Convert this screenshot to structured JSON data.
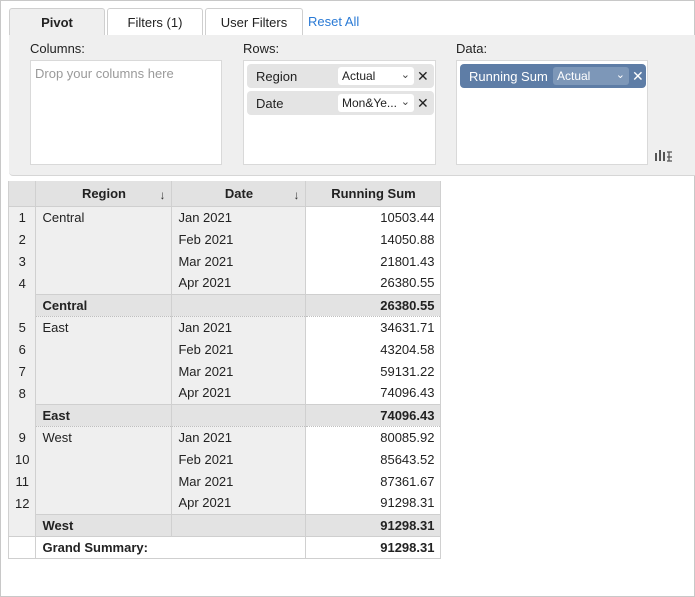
{
  "tabs": [
    {
      "label": "Pivot",
      "active": true
    },
    {
      "label": "Filters (1)",
      "active": false
    },
    {
      "label": "User Filters",
      "active": false
    }
  ],
  "reset_label": "Reset All",
  "panel": {
    "columns_label": "Columns:",
    "columns_placeholder": "Drop your columns here",
    "rows_label": "Rows:",
    "rows": [
      {
        "label": "Region",
        "value": "Actual"
      },
      {
        "label": "Date",
        "value": "Mon&Ye..."
      }
    ],
    "data_label": "Data:",
    "data": [
      {
        "label": "Running Sum",
        "value": "Actual"
      }
    ],
    "layout_icon": "chart-layout-icon",
    "accent_color": "#5e7da6"
  },
  "table": {
    "headers": {
      "region": "Region",
      "date": "Date",
      "sum": "Running Sum"
    },
    "groups": [
      {
        "region": "Central",
        "rows": [
          {
            "n": "1",
            "date": "Jan 2021",
            "value": "10503.44"
          },
          {
            "n": "2",
            "date": "Feb 2021",
            "value": "14050.88"
          },
          {
            "n": "3",
            "date": "Mar 2021",
            "value": "21801.43"
          },
          {
            "n": "4",
            "date": "Apr 2021",
            "value": "26380.55"
          }
        ],
        "subtotal": "26380.55"
      },
      {
        "region": "East",
        "rows": [
          {
            "n": "5",
            "date": "Jan 2021",
            "value": "34631.71"
          },
          {
            "n": "6",
            "date": "Feb 2021",
            "value": "43204.58"
          },
          {
            "n": "7",
            "date": "Mar 2021",
            "value": "59131.22"
          },
          {
            "n": "8",
            "date": "Apr 2021",
            "value": "74096.43"
          }
        ],
        "subtotal": "74096.43"
      },
      {
        "region": "West",
        "rows": [
          {
            "n": "9",
            "date": "Jan 2021",
            "value": "80085.92"
          },
          {
            "n": "10",
            "date": "Feb 2021",
            "value": "85643.52"
          },
          {
            "n": "11",
            "date": "Mar 2021",
            "value": "87361.67"
          },
          {
            "n": "12",
            "date": "Apr 2021",
            "value": "91298.31"
          }
        ],
        "subtotal": "91298.31"
      }
    ],
    "grand_label": "Grand Summary:",
    "grand_value": "91298.31"
  }
}
